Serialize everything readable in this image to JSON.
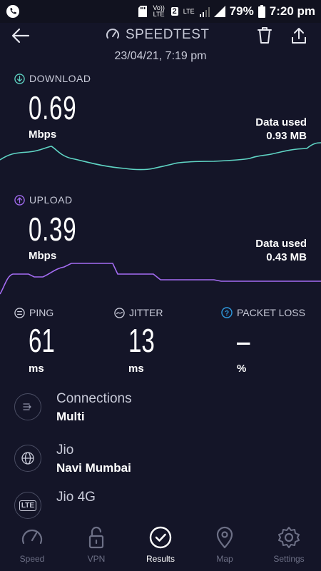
{
  "status_bar": {
    "volte": "Vo)) LTE",
    "sim_slot": "2",
    "network": "LTE",
    "battery": "79%",
    "time": "7:20 pm"
  },
  "header": {
    "title": "SPEEDTEST",
    "datetime": "23/04/21, 7:19 pm"
  },
  "download": {
    "label": "DOWNLOAD",
    "value": "0.69",
    "unit": "Mbps",
    "data_used_label": "Data used",
    "data_used_value": "0.93 MB",
    "color": "#5fd4c4"
  },
  "upload": {
    "label": "UPLOAD",
    "value": "0.39",
    "unit": "Mbps",
    "data_used_label": "Data used",
    "data_used_value": "0.43 MB",
    "color": "#a46cf2"
  },
  "ping": {
    "label": "PING",
    "value": "61",
    "unit": "ms"
  },
  "jitter": {
    "label": "JITTER",
    "value": "13",
    "unit": "ms"
  },
  "packet_loss": {
    "label": "PACKET LOSS",
    "value": "–",
    "unit": "%",
    "color": "#2f9be0"
  },
  "connections": {
    "title": "Connections",
    "subtitle": "Multi"
  },
  "server": {
    "title": "Jio",
    "subtitle": "Navi Mumbai"
  },
  "provider": {
    "title": "Jio 4G",
    "icon_text": "LTE"
  },
  "nav": {
    "items": [
      "Speed",
      "VPN",
      "Results",
      "Map",
      "Settings"
    ],
    "active": "Results"
  }
}
